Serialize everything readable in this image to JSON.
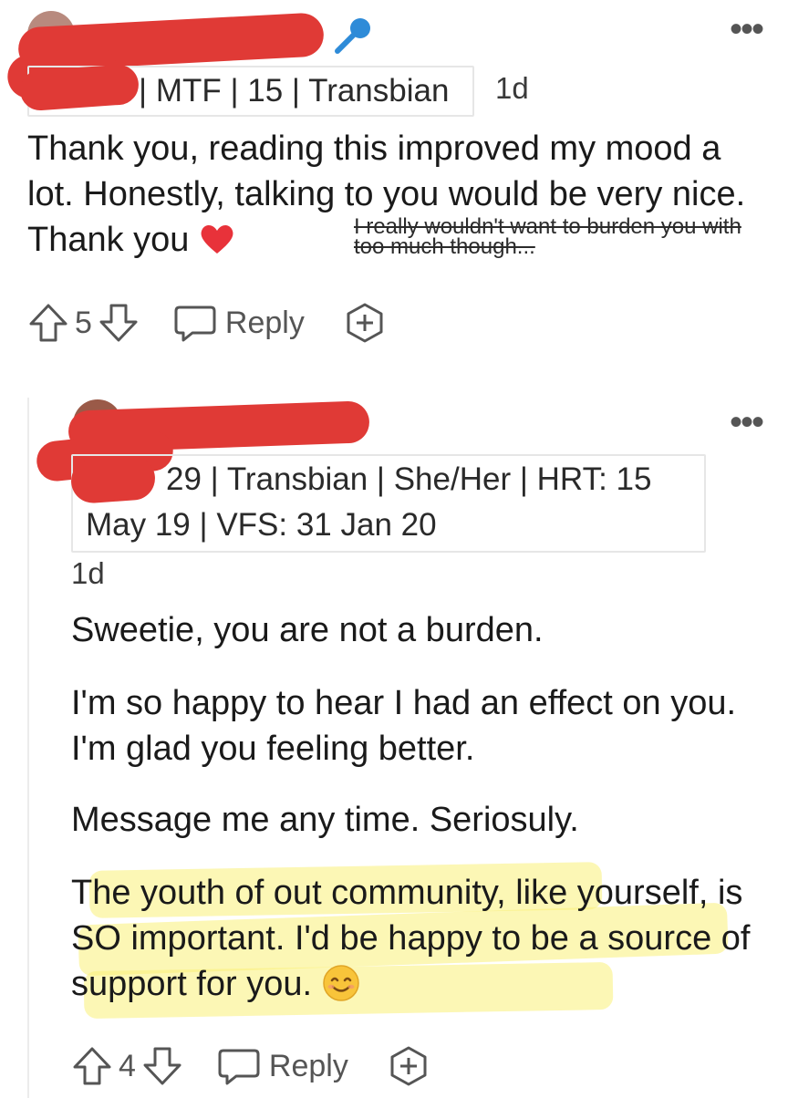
{
  "comment1": {
    "flair": "| MTF | 15 | Transbian",
    "time": "1d",
    "text": "Thank you, reading this improved my mood a lot. Honestly, talking to you would be very nice. Thank you",
    "strikethrough": "I really wouldn't want to burden you with too much though...",
    "votes": "5",
    "reply_label": "Reply"
  },
  "comment2": {
    "flair_line1": "29 | Transbian | She/Her | HRT: 15",
    "flair_line2": "May 19 | VFS: 31 Jan 20",
    "time": "1d",
    "p1": "Sweetie, you are not a burden.",
    "p2": "I'm so happy to hear I had an effect on you. I'm glad you feeling better.",
    "p3": "Message me any time. Seriosuly.",
    "p4": "The youth of out community, like yourself, is SO important. I'd be happy to be a source of support for you.",
    "votes": "4",
    "reply_label": "Reply"
  },
  "icons": {
    "more": "more-options-icon",
    "mic": "microphone-icon",
    "upvote": "upvote-arrow-icon",
    "downvote": "downvote-arrow-icon",
    "reply": "speech-bubble-icon",
    "award": "award-plus-icon",
    "heart": "red-heart-emoji",
    "smile": "smiling-face-emoji"
  },
  "colors": {
    "redaction": "#e03a36",
    "highlight": "#f7ef7a",
    "mic": "#2e8bd8"
  }
}
